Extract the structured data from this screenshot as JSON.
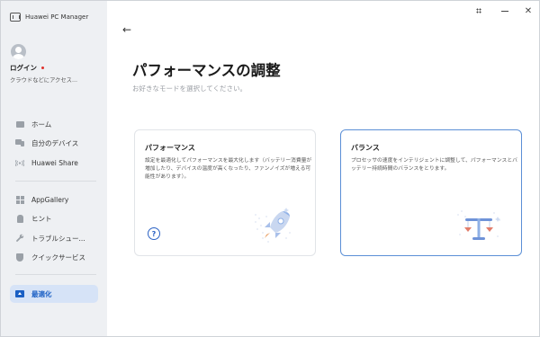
{
  "app": {
    "title": "Huawei PC Manager"
  },
  "window_controls": {
    "more_icon": "grid-dots-icon",
    "minimize_icon": "minimize-icon",
    "close_glyph": "✕"
  },
  "sidebar": {
    "login_label": "ログイン",
    "cloud_text": "クラウドなどにアクセス...",
    "items": [
      {
        "label": "ホーム",
        "icon": "home-icon"
      },
      {
        "label": "自分のデバイス",
        "icon": "devices-icon"
      },
      {
        "label": "Huawei Share",
        "icon": "share-icon"
      },
      {
        "label": "AppGallery",
        "icon": "appgallery-icon"
      },
      {
        "label": "ヒント",
        "icon": "tips-icon"
      },
      {
        "label": "トラブルシュー...",
        "icon": "wrench-icon"
      },
      {
        "label": "クイックサービス",
        "icon": "shield-icon"
      },
      {
        "label": "最適化",
        "icon": "optimize-icon",
        "active": true
      }
    ]
  },
  "main": {
    "back_glyph": "←",
    "title": "パフォーマンスの調整",
    "subtitle": "お好きなモードを選択してください。",
    "cards": [
      {
        "title": "パフォーマンス",
        "description": "設定を最適化してパフォーマンスを最大化します（バッテリー消費量が増加したり、デバイスの温度が高くなったり、ファンノイズが増える可能性があります）。",
        "help_glyph": "?",
        "selected": false
      },
      {
        "title": "バランス",
        "description": "プロセッサの速度をインテリジェントに調整して、パフォーマンスとバッテリー持続時間のバランスをとります。",
        "selected": true
      }
    ]
  },
  "colors": {
    "accent": "#1a5fc4",
    "selected_border": "#5b8fd6",
    "sidebar_bg": "#eef0f3",
    "active_nav_bg": "#d6e3f7",
    "login_dot": "#e0302a"
  }
}
